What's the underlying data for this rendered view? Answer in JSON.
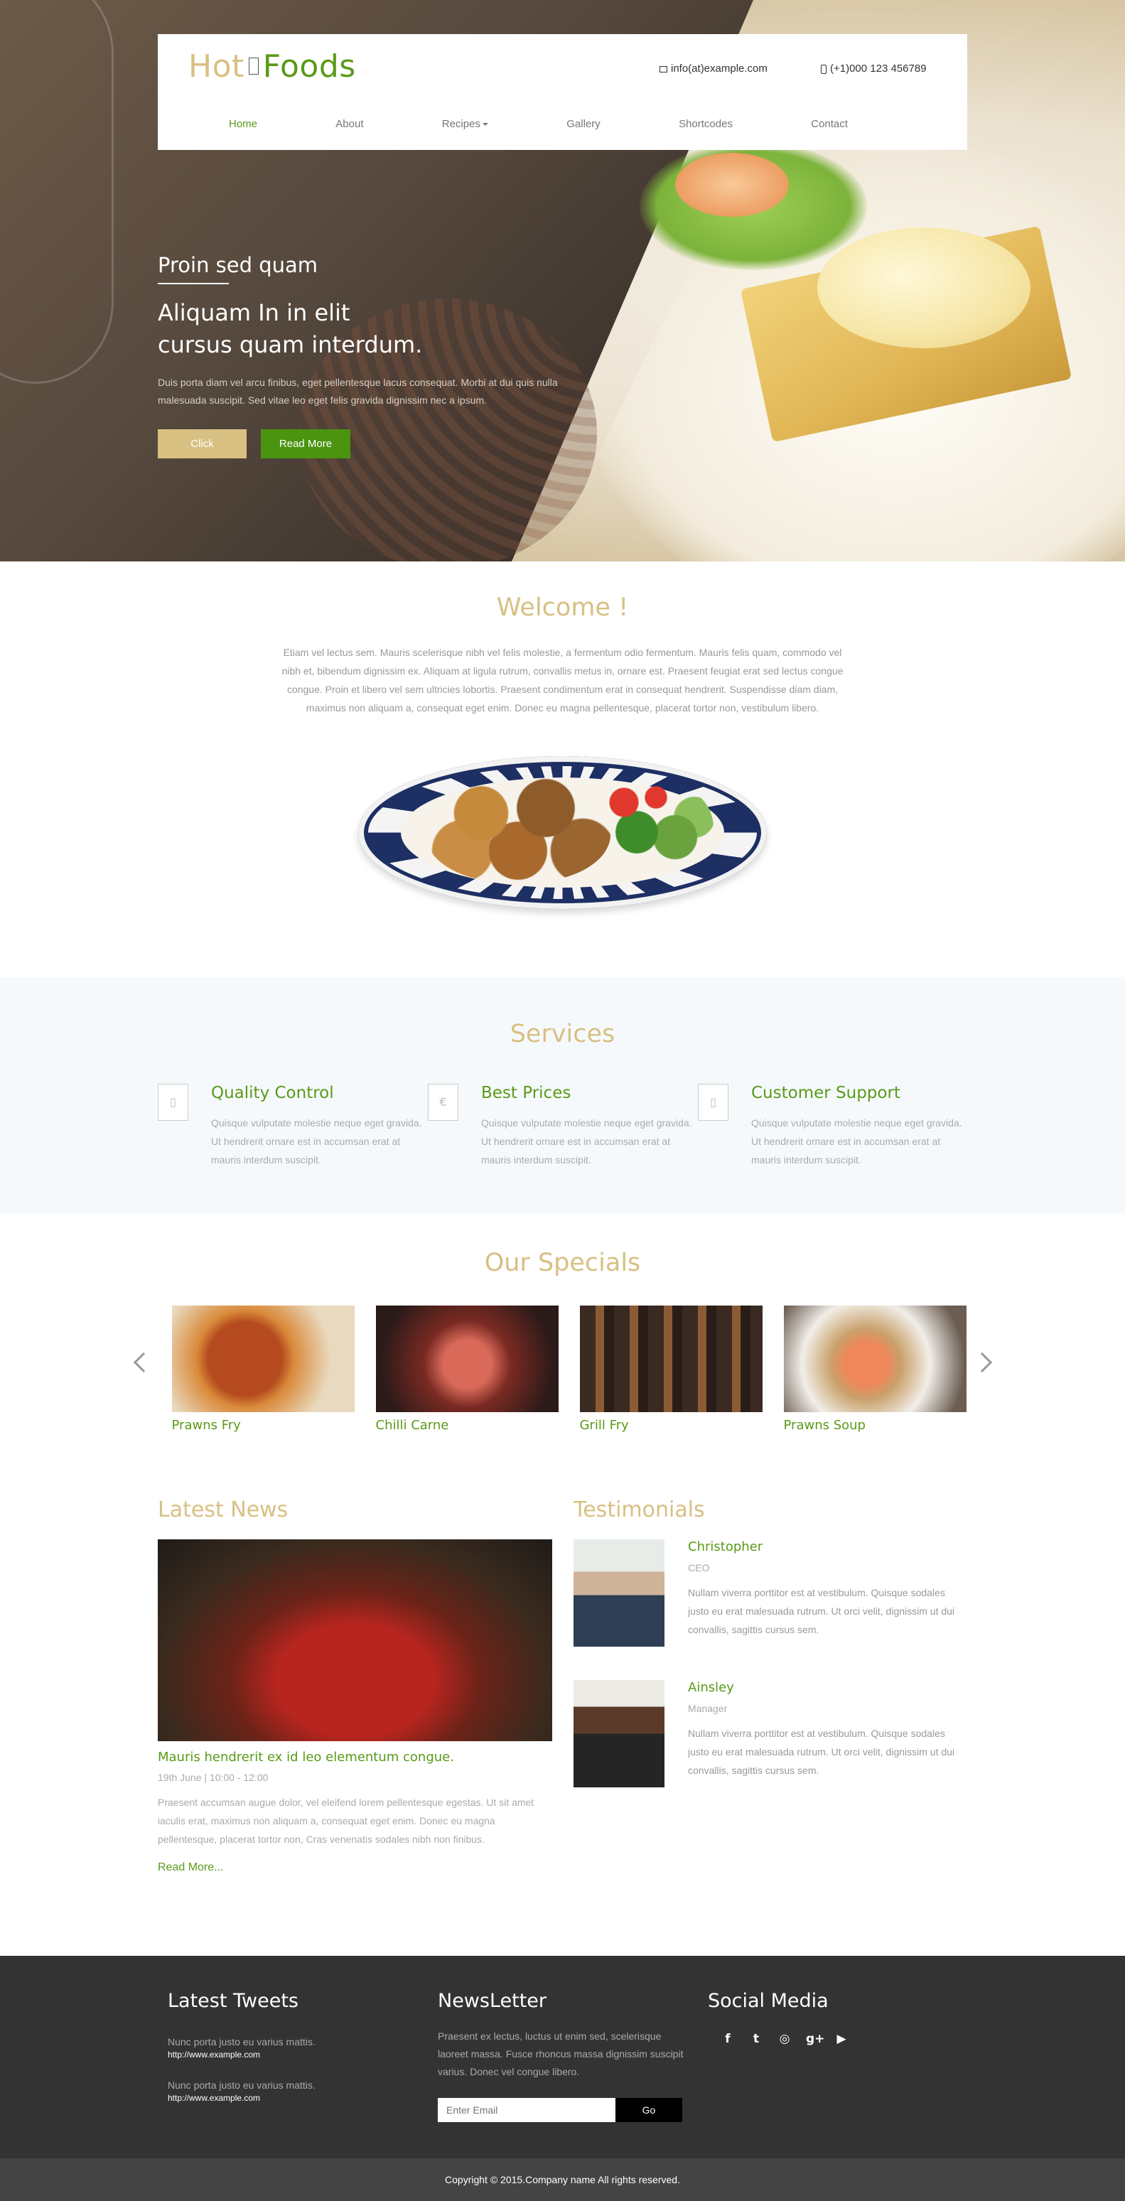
{
  "brand": {
    "part1": "Hot",
    "part2": "Foods"
  },
  "contact": {
    "email": "info(at)example.com",
    "phone": "(+1)000 123 456789"
  },
  "nav": {
    "home": "Home",
    "about": "About",
    "recipes": "Recipes",
    "gallery": "Gallery",
    "shortcodes": "Shortcodes",
    "contact": "Contact"
  },
  "hero": {
    "kicker": "Proin sed quam",
    "headline_line1": "Aliquam In in elit",
    "headline_line2": "cursus quam interdum.",
    "paragraph": "Duis porta diam vel arcu finibus, eget pellentesque lacus consequat. Morbi at dui quis nulla malesuada suscipit. Sed vitae leo eget felis gravida dignissim nec a ipsum.",
    "btn_click": "Click",
    "btn_read_more": "Read More"
  },
  "welcome": {
    "title": "Welcome !",
    "text": "Etiam vel lectus sem. Mauris scelerisque nibh vel felis molestie, a fermentum odio fermentum. Mauris felis quam, commodo vel nibh et, bibendum dignissim ex. Aliquam at ligula rutrum, convallis metus in, ornare est. Praesent feugiat erat sed lectus congue congue. Proin et libero vel sem ultricies lobortis. Praesent condimentum erat in consequat hendrerit. Suspendisse diam diam, maximus non aliquam a, consequat eget enim. Donec eu magna pellentesque, placerat tortor non, vestibulum libero."
  },
  "services": {
    "title": "Services",
    "items": [
      {
        "icon": "phone-icon",
        "icon_glyph": "▯",
        "title": "Quality Control",
        "desc": "Quisque vulputate molestie neque eget gravida. Ut hendrerit ornare est in accumsan erat at mauris interdum suscipit."
      },
      {
        "icon": "euro-icon",
        "icon_glyph": "€",
        "title": "Best Prices",
        "desc": "Quisque vulputate molestie neque eget gravida. Ut hendrerit ornare est in accumsan erat at mauris interdum suscipit."
      },
      {
        "icon": "phone-icon",
        "icon_glyph": "▯",
        "title": "Customer Support",
        "desc": "Quisque vulputate molestie neque eget gravida. Ut hendrerit ornare est in accumsan erat at mauris interdum suscipit."
      }
    ]
  },
  "specials": {
    "title": "Our Specials",
    "items": [
      {
        "name": "Prawns Fry"
      },
      {
        "name": "Chilli Carne"
      },
      {
        "name": "Grill Fry"
      },
      {
        "name": "Prawns Soup"
      }
    ]
  },
  "news": {
    "title": "Latest News",
    "headline": "Mauris hendrerit ex id leo elementum congue.",
    "meta": "19th June | 10:00 - 12:00",
    "body": "Praesent accumsan augue dolor, vel eleifend lorem pellentesque egestas. Ut sit amet iaculis erat, maximus non aliquam a, consequat eget enim. Donec eu magna pellentesque, placerat tortor non, Cras venenatis sodales nibh non finibus.",
    "read_more": "Read More..."
  },
  "testimonials": {
    "title": "Testimonials",
    "items": [
      {
        "name": "Christopher",
        "role": "CEO",
        "quote": "Nullam viverra porttitor est at vestibulum. Quisque sodales justo eu erat malesuada rutrum. Ut orci velit, dignissim ut dui convallis, sagittis cursus sem."
      },
      {
        "name": "Ainsley",
        "role": "Manager",
        "quote": "Nullam viverra porttitor est at vestibulum. Quisque sodales justo eu erat malesuada rutrum. Ut orci velit, dignissim ut dui convallis, sagittis cursus sem."
      }
    ]
  },
  "footer": {
    "tweets_title": "Latest Tweets",
    "tweets": [
      {
        "text": "Nunc porta justo eu varius mattis.",
        "url": "http://www.example.com"
      },
      {
        "text": "Nunc porta justo eu varius mattis.",
        "url": "http://www.example.com"
      }
    ],
    "newsletter_title": "NewsLetter",
    "newsletter_desc": "Praesent ex lectus, luctus ut enim sed, scelerisque laoreet massa. Fusce rhoncus massa dignissim suscipit varius. Donec vel congue libero.",
    "email_placeholder": "Enter Email",
    "go_label": "Go",
    "social_title": "Social Media",
    "social": [
      {
        "icon": "facebook-icon",
        "glyph": "f"
      },
      {
        "icon": "twitter-icon",
        "glyph": "t"
      },
      {
        "icon": "dribbble-icon",
        "glyph": "◎"
      },
      {
        "icon": "google-plus-icon",
        "glyph": "g+"
      },
      {
        "icon": "youtube-icon",
        "glyph": "▶"
      }
    ],
    "copyright": "Copyright © 2015.Company name All rights reserved."
  },
  "colors": {
    "green": "#5a9a18",
    "tan": "#d8c083",
    "footer_bg": "#333333"
  }
}
